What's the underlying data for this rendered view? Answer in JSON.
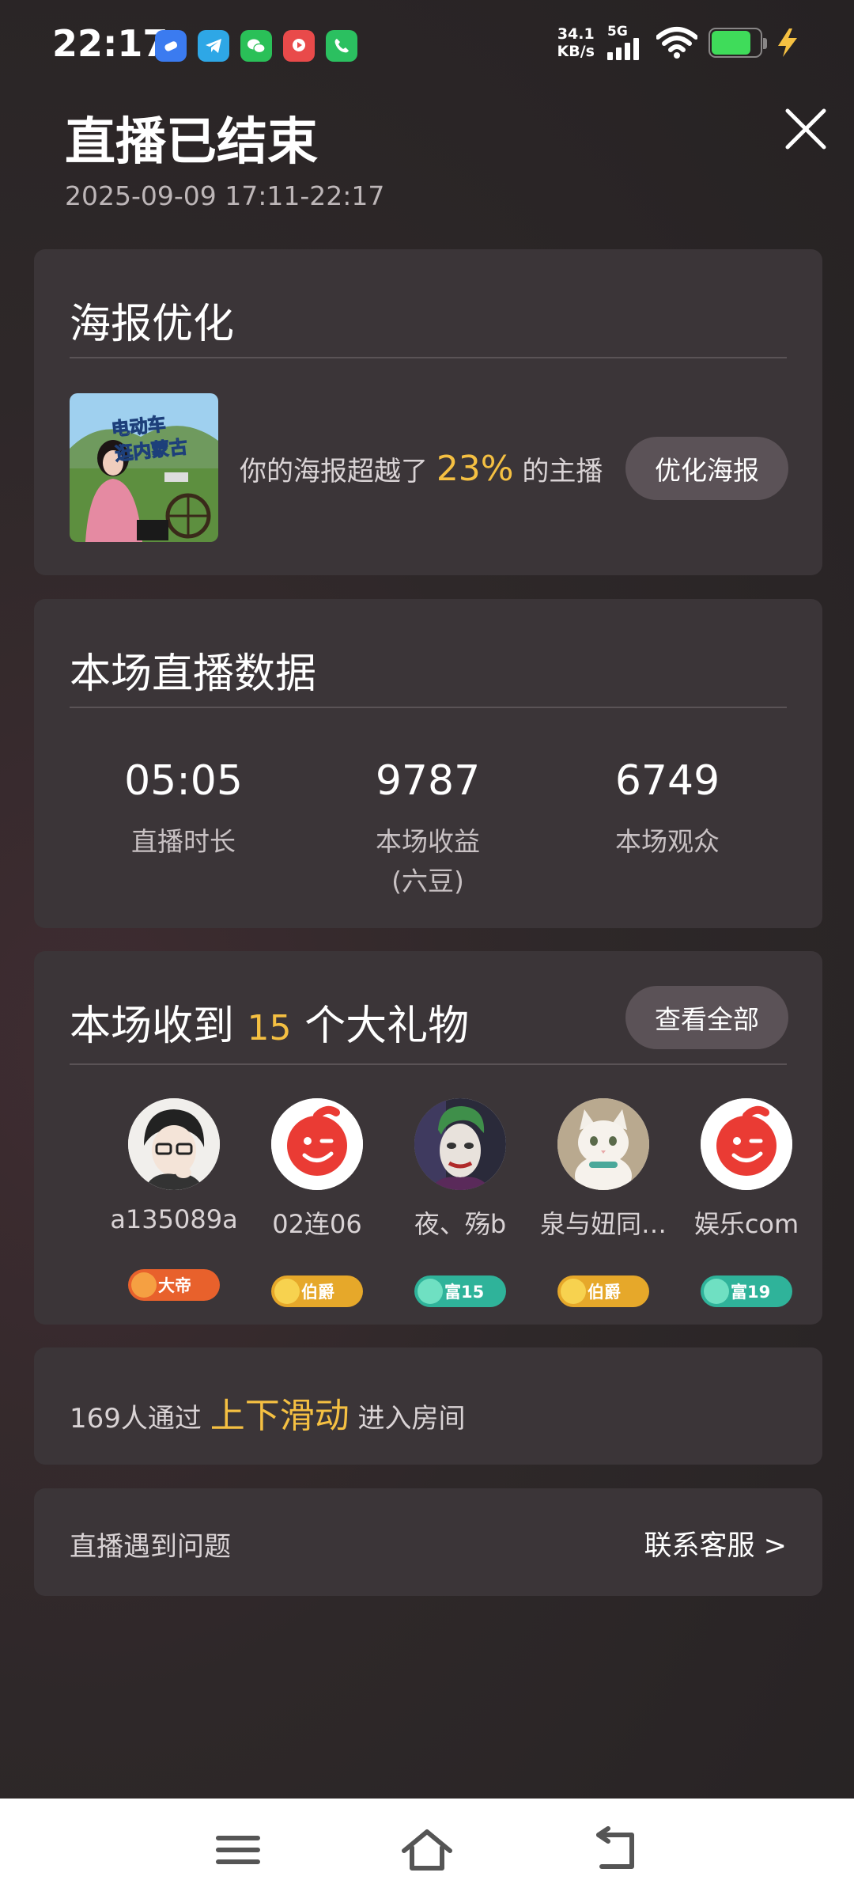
{
  "status_bar": {
    "time": "22:17",
    "net_speed_value": "34.1",
    "net_speed_unit": "KB/s",
    "network": "5G",
    "apps": [
      "browser-app-icon",
      "telegram-app-icon",
      "wechat-app-icon",
      "video-app-icon",
      "phone-app-icon"
    ]
  },
  "header": {
    "title": "直播已结束",
    "time_range": "2025-09-09 17:11-22:17"
  },
  "poster": {
    "title": "海报优化",
    "text_before": "你的海报超越了",
    "percent": "23%",
    "text_after": "的主播",
    "button": "优化海报",
    "thumb_line1": "电动车",
    "thumb_line2": "逛内蒙古"
  },
  "stats": {
    "title": "本场直播数据",
    "items": [
      {
        "value": "05:05",
        "label": "直播时长"
      },
      {
        "value": "9787",
        "label": "本场收益",
        "sub": "(六豆)"
      },
      {
        "value": "6749",
        "label": "本场观众"
      }
    ]
  },
  "gifts": {
    "title_before": "本场收到",
    "count": "15",
    "title_after": "个大礼物",
    "button": "查看全部",
    "gifters": [
      {
        "name": "a135089a",
        "badge": "大帝",
        "badge_color": "#e8612c"
      },
      {
        "name": "02连06",
        "badge": "伯爵",
        "badge_color": "#e6a82a"
      },
      {
        "name": "夜、殇b",
        "badge": "富15",
        "badge_color": "#2fb39a"
      },
      {
        "name": "泉与妞同…",
        "badge": "伯爵",
        "badge_color": "#e6a82a"
      },
      {
        "name": "娱乐com",
        "badge": "富19",
        "badge_color": "#2fb39a"
      }
    ]
  },
  "swipe": {
    "count_text": "169人通过",
    "highlight": "上下滑动",
    "text_after": "进入房间"
  },
  "help": {
    "label": "直播遇到问题",
    "link": "联系客服 >"
  },
  "colors": {
    "accent": "#f5c042",
    "card_bg": "#3b3538",
    "button_bg": "#5b5257",
    "battery": "#3fdc5a"
  }
}
